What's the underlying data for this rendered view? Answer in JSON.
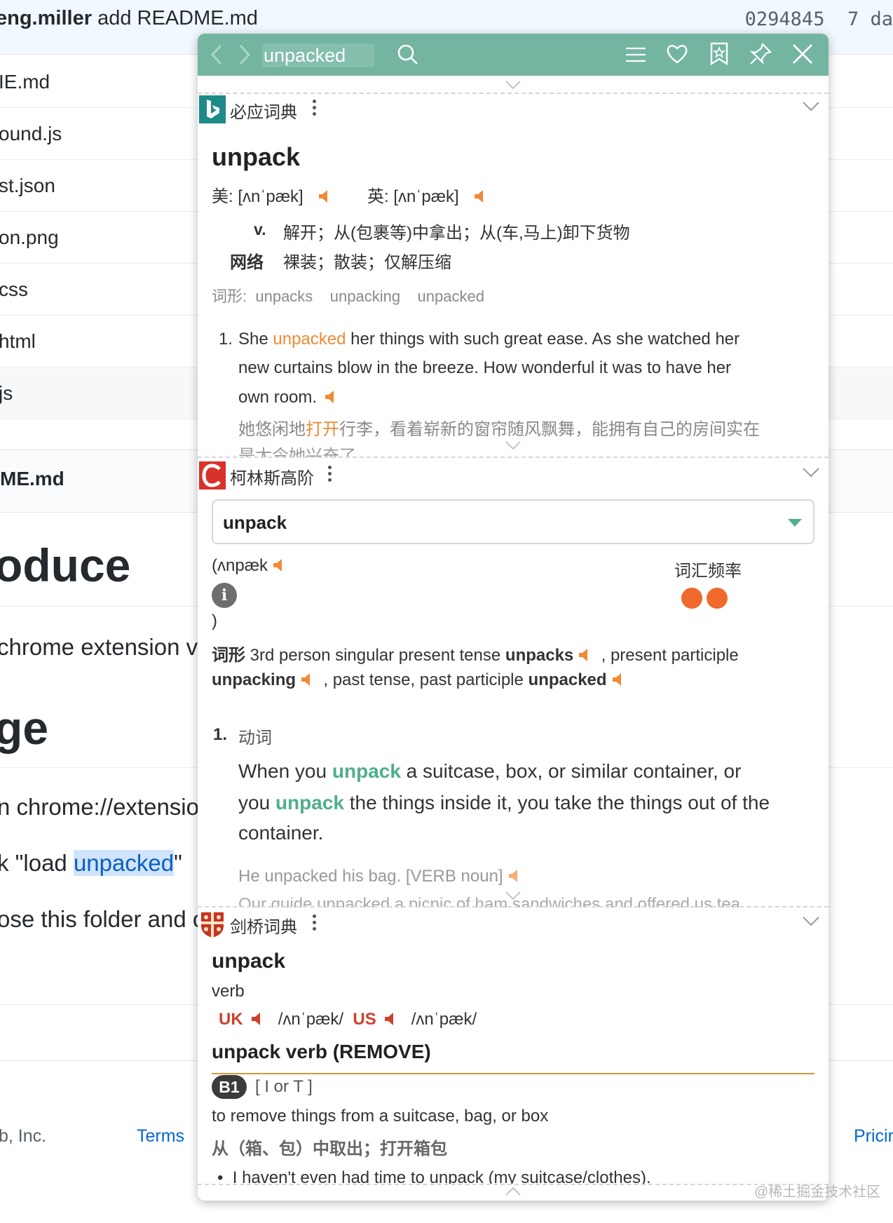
{
  "background": {
    "commit": {
      "author": "eng.miller",
      "message": "add README.md",
      "sha": "0294845",
      "age": "7 da"
    },
    "files": [
      "IE.md",
      "ound.js",
      "st.json",
      "on.png",
      "css",
      "html",
      "js"
    ],
    "readme_name": "ME.md",
    "heading_1": "oduce",
    "para_1": "chrome extension v",
    "heading_2": "ge",
    "step_1": "n chrome://extensio",
    "step_2_prefix": "k \"load ",
    "step_2_highlight": "unpacked",
    "step_2_suffix": "\"",
    "step_3": "ose this folder and c",
    "footer_company": "b, Inc.",
    "footer_terms": "Terms",
    "footer_pricing": "Pricir"
  },
  "popup": {
    "search_value": "unpacked",
    "icons": [
      "back-icon",
      "forward-icon",
      "search-icon",
      "menu-icon",
      "heart-icon",
      "bookmark-icon",
      "pin-icon",
      "close-icon"
    ],
    "accent_color": "#74b5a1",
    "bing": {
      "title": "必应词典",
      "word": "unpack",
      "us_label": "美:",
      "us_phonetic": "[ʌnˈpæk]",
      "uk_label": "英:",
      "uk_phonetic": "[ʌnˈpæk]",
      "pos_v": "v.",
      "def_v": "解开；从(包裹等)中拿出；从(车,马上)卸下货物",
      "pos_web": "网络",
      "def_web": "裸装；散装；仅解压缩",
      "forms_label": "词形:",
      "forms": [
        "unpacks",
        "unpacking",
        "unpacked"
      ],
      "example_num": "1.",
      "example_pre": "She ",
      "example_hl": "unpacked",
      "example_post": " her things with such great ease. As she watched her",
      "example_l2": "new curtains blow in the breeze. How wonderful it was to have her",
      "example_l3": "own room.",
      "example_cn_pre": "她悠闲地",
      "example_cn_hl": "打开",
      "example_cn_post": "行李，看着崭新的窗帘随风飘舞，能拥有自己的房间实在",
      "example_cn_l2": "是太令她兴奋了。"
    },
    "collins": {
      "title": "柯林斯高阶",
      "selected": "unpack",
      "phonetic": "(ʌnpæk",
      "close_paren": ")",
      "info_glyph": "i",
      "freq_label": "词汇频率",
      "forms_label": "词形",
      "form_1_desc": "3rd person singular present tense",
      "form_1": "unpacks",
      "form_2_desc": ", present participle",
      "form_2": "unpacking",
      "form_3_desc": ", past tense, past participle",
      "form_3": "unpacked",
      "sense_num": "1.",
      "sense_pos": "动词",
      "def_l1_pre": "When you ",
      "def_l1_hl": "unpack",
      "def_l1_post": " a suitcase, box, or similar container, or",
      "def_l2_pre": "you ",
      "def_l2_hl": "unpack",
      "def_l2_post": " the things inside it, you take the things out of the",
      "def_l3": "container.",
      "ex_1": "He unpacked his bag. [VERB noun]",
      "ex_2": "Our guide unpacked a picnic of ham sandwiches and offered us tea."
    },
    "cambridge": {
      "title": "剑桥词典",
      "word": "unpack",
      "pos": "verb",
      "uk_label": "UK",
      "uk_ipa": "/ʌnˈpæk/",
      "us_label": "US",
      "us_ipa": "/ʌnˈpæk/",
      "sense_head": "unpack verb (REMOVE)",
      "level": "B1",
      "grammar": "[ I or T ]",
      "definition": "to remove things from a suitcase, bag, or box",
      "translation": "从（箱、包）中取出；打开箱包",
      "example": "I haven't even had time to unpack (my suitcase/clothes)."
    }
  },
  "watermark": "@稀土掘金技术社区"
}
